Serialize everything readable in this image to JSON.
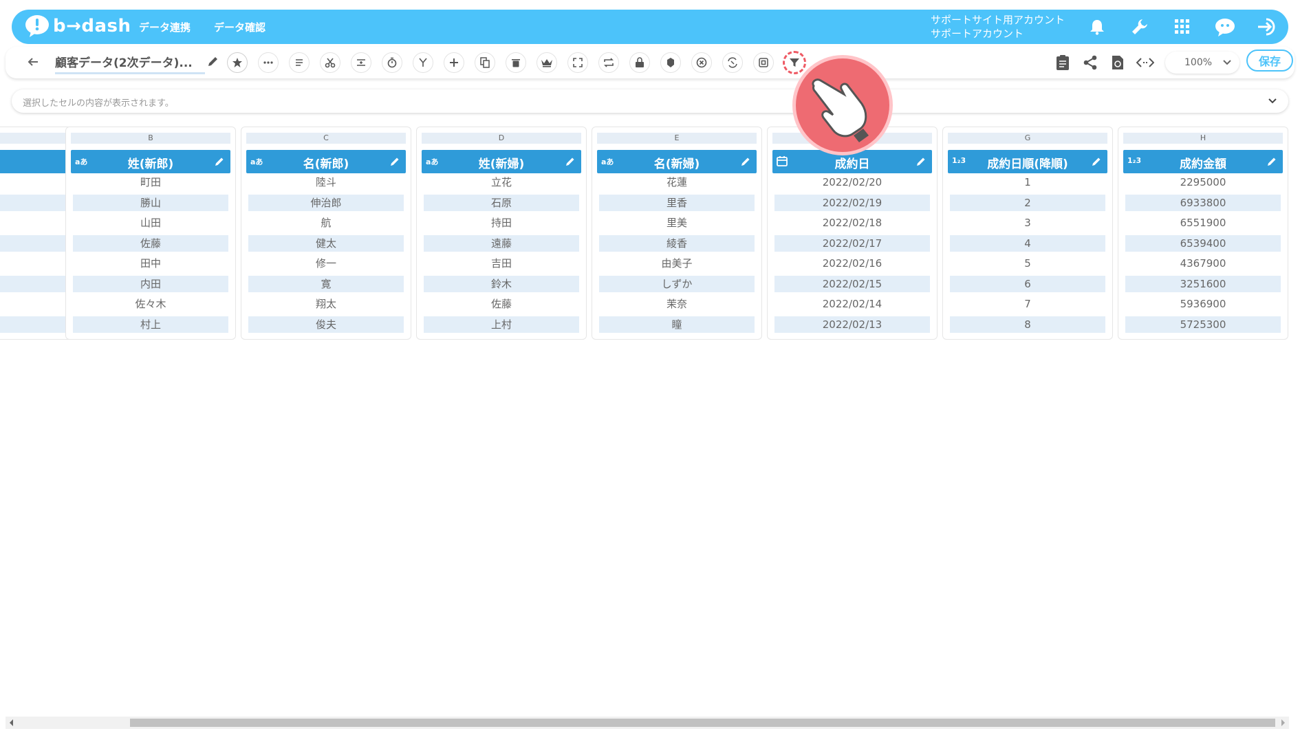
{
  "header": {
    "brand": "b→dash",
    "nav": [
      "データ連携",
      "データ確認"
    ],
    "account_line1": "サポートサイト用アカウント",
    "account_line2": "サポートアカウント",
    "icons": [
      "bell-icon",
      "wrench-icon",
      "apps-grid-icon",
      "support-chat-icon",
      "logout-icon"
    ]
  },
  "toolbar": {
    "title": "顧客データ(2次データ)...",
    "tools": [
      "star-icon",
      "ellipsis-icon",
      "text-lines-icon",
      "cut-icon",
      "merge-icon",
      "timer-icon",
      "branch-icon",
      "add-icon",
      "copy-icon",
      "trash-icon",
      "crown-icon",
      "expand-icon",
      "repeat-icon",
      "lock-icon",
      "export-icon",
      "close-circle-icon",
      "transform-icon",
      "square-icon",
      "filter-icon"
    ],
    "active_tool": "filter-icon",
    "zoom": "100%",
    "save_label": "保存"
  },
  "cellbar": {
    "placeholder": "選択したセルの内容が表示されます。"
  },
  "grid": {
    "columns": [
      {
        "letter": "",
        "type": "",
        "name": "",
        "cells": [
          "",
          "",
          "",
          "",
          "",
          "",
          "",
          ""
        ]
      },
      {
        "letter": "B",
        "type": "aあ",
        "name": "姓(新郎)",
        "cells": [
          "町田",
          "勝山",
          "山田",
          "佐藤",
          "田中",
          "内田",
          "佐々木",
          "村上"
        ]
      },
      {
        "letter": "C",
        "type": "aあ",
        "name": "名(新郎)",
        "cells": [
          "陸斗",
          "伸治郎",
          "航",
          "健太",
          "修一",
          "寛",
          "翔太",
          "俊夫"
        ]
      },
      {
        "letter": "D",
        "type": "aあ",
        "name": "姓(新婦)",
        "cells": [
          "立花",
          "石原",
          "持田",
          "遠藤",
          "吉田",
          "鈴木",
          "佐藤",
          "上村"
        ]
      },
      {
        "letter": "E",
        "type": "aあ",
        "name": "名(新婦)",
        "cells": [
          "花蓮",
          "里香",
          "里美",
          "綾香",
          "由美子",
          "しずか",
          "茉奈",
          "瞳"
        ]
      },
      {
        "letter": "",
        "type": "",
        "name": "成約日",
        "cells": [
          "2022/02/20",
          "2022/02/19",
          "2022/02/18",
          "2022/02/17",
          "2022/02/16",
          "2022/02/15",
          "2022/02/14",
          "2022/02/13"
        ]
      },
      {
        "letter": "G",
        "type": "1₂3",
        "name": "成約日順(降順)",
        "cells": [
          "1",
          "2",
          "3",
          "4",
          "5",
          "6",
          "7",
          "8"
        ]
      },
      {
        "letter": "H",
        "type": "1₂3",
        "name": "成約金額",
        "cells": [
          "2295000",
          "6933800",
          "6551900",
          "6539400",
          "4367900",
          "3251600",
          "5936900",
          "5725300"
        ]
      }
    ]
  },
  "colors": {
    "brand": "#4cc3fa",
    "header_blue": "#2f9bd9",
    "alt_row": "#e3eef8",
    "highlight": "#ee6b72"
  }
}
